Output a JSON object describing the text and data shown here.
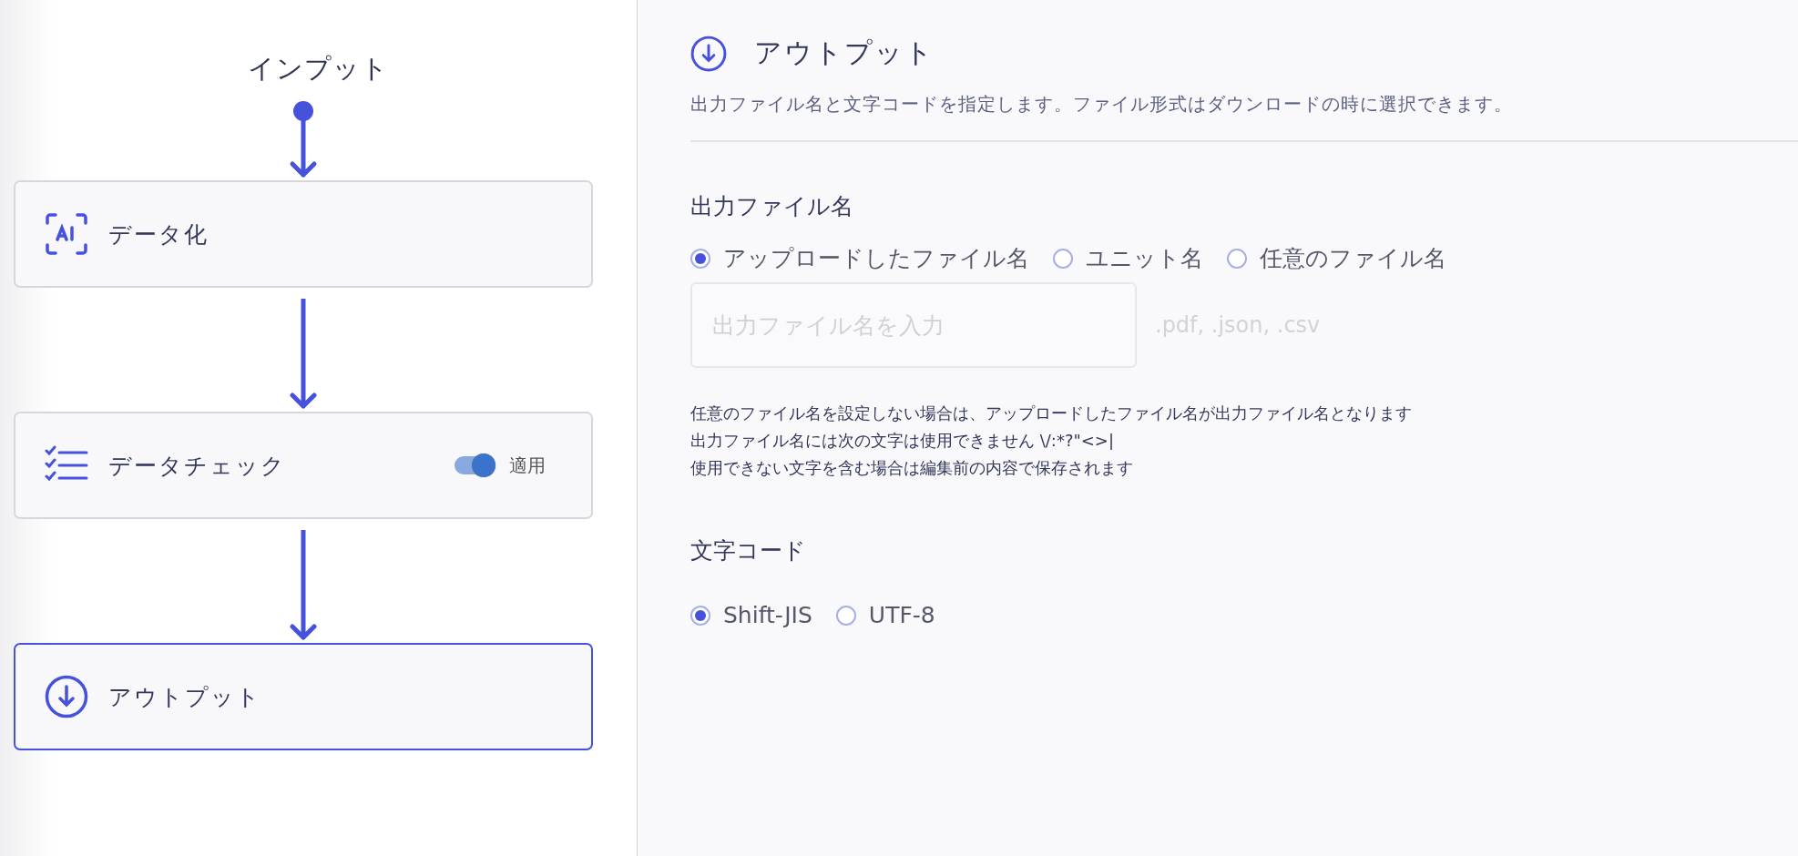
{
  "flow": {
    "input_label": "インプット",
    "steps": [
      {
        "kind": "ai",
        "label": "データ化",
        "selected": false
      },
      {
        "kind": "checklist",
        "label": "データチェック",
        "selected": false,
        "toggle": {
          "on": true,
          "label": "適用"
        }
      },
      {
        "kind": "output",
        "label": "アウトプット",
        "selected": true
      }
    ]
  },
  "panel": {
    "title": "アウトプット",
    "description": "出力ファイル名と文字コードを指定します。ファイル形式はダウンロードの時に選択できます。",
    "filename": {
      "heading": "出力ファイル名",
      "options": [
        {
          "label": "アップロードしたファイル名",
          "selected": true
        },
        {
          "label": "ユニット名",
          "selected": false
        },
        {
          "label": "任意のファイル名",
          "selected": false
        }
      ],
      "field": {
        "placeholder": "出力ファイル名を入力",
        "suffix": ".pdf, .json, .csv"
      },
      "help": [
        "任意のファイル名を設定しない場合は、アップロードしたファイル名が出力ファイル名となります",
        "出力ファイル名には次の文字は使用できません \\/:*?\"<>|",
        "使用できない文字を含む場合は編集前の内容で保存されます"
      ]
    },
    "encoding": {
      "heading": "文字コード",
      "options": [
        {
          "label": "Shift-JIS",
          "selected": true
        },
        {
          "label": "UTF-8",
          "selected": false
        }
      ]
    }
  }
}
